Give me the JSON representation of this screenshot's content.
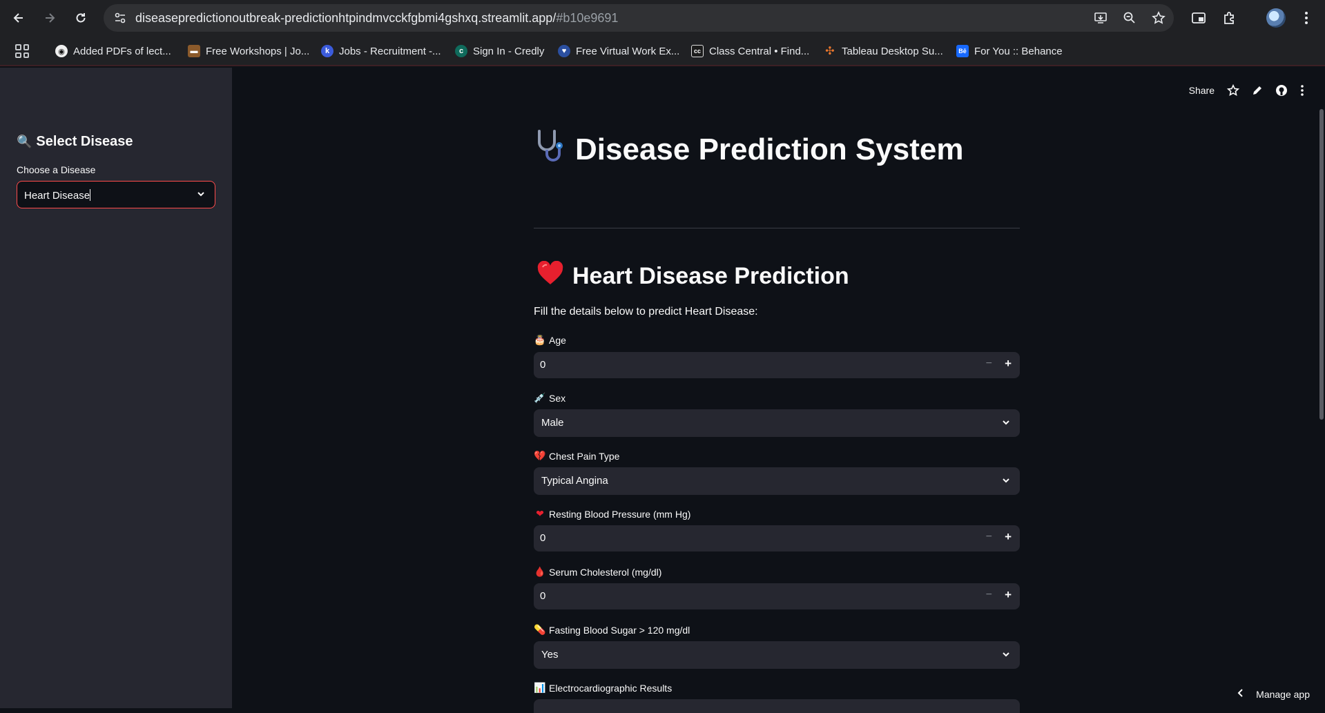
{
  "browser": {
    "url_host": "diseasepredictionoutbreak-predictionhtpindmvcckfgbmi4gshxq.streamlit.app/",
    "url_hash": "#b10e9691",
    "bookmarks": [
      {
        "label": "Added PDFs of lect...",
        "icon": "github-icon",
        "color": "#1f1f1f"
      },
      {
        "label": "Free Workshops | Jo...",
        "icon": "briefcase-icon",
        "color": "#8b5a2b"
      },
      {
        "label": "Jobs - Recruitment -...",
        "icon": "jobs-icon",
        "color": "#3b5bdb"
      },
      {
        "label": "Sign In - Credly",
        "icon": "credly-icon",
        "color": "#0f6b5c"
      },
      {
        "label": "Free Virtual Work Ex...",
        "icon": "forage-icon",
        "color": "#2b4fa0"
      },
      {
        "label": "Class Central • Find...",
        "icon": "classcentral-icon",
        "color": "#333"
      },
      {
        "label": "Tableau Desktop Su...",
        "icon": "tableau-icon",
        "color": "#e8762d"
      },
      {
        "label": "For You :: Behance",
        "icon": "behance-icon",
        "color": "#1769ff"
      }
    ]
  },
  "toolbar": {
    "share_label": "Share"
  },
  "sidebar": {
    "title": "Select Disease",
    "select_label": "Choose a Disease",
    "select_value": "Heart Disease"
  },
  "main": {
    "title": "Disease Prediction System",
    "section_title": "Heart Disease Prediction",
    "description": "Fill the details below to predict Heart Disease:",
    "fields": {
      "age": {
        "label": "Age",
        "value": "0"
      },
      "sex": {
        "label": "Sex",
        "value": "Male"
      },
      "chest_pain": {
        "label": "Chest Pain Type",
        "value": "Typical Angina"
      },
      "bp": {
        "label": "Resting Blood Pressure (mm Hg)",
        "value": "0"
      },
      "chol": {
        "label": "Serum Cholesterol (mg/dl)",
        "value": "0"
      },
      "fbs": {
        "label": "Fasting Blood Sugar > 120 mg/dl",
        "value": "Yes"
      },
      "ecg": {
        "label": "Electrocardiographic Results"
      }
    }
  },
  "footer": {
    "manage_label": "Manage app"
  },
  "colors": {
    "accent": "#ff4b4b",
    "background": "#0e1117",
    "sidebar": "#262730"
  }
}
